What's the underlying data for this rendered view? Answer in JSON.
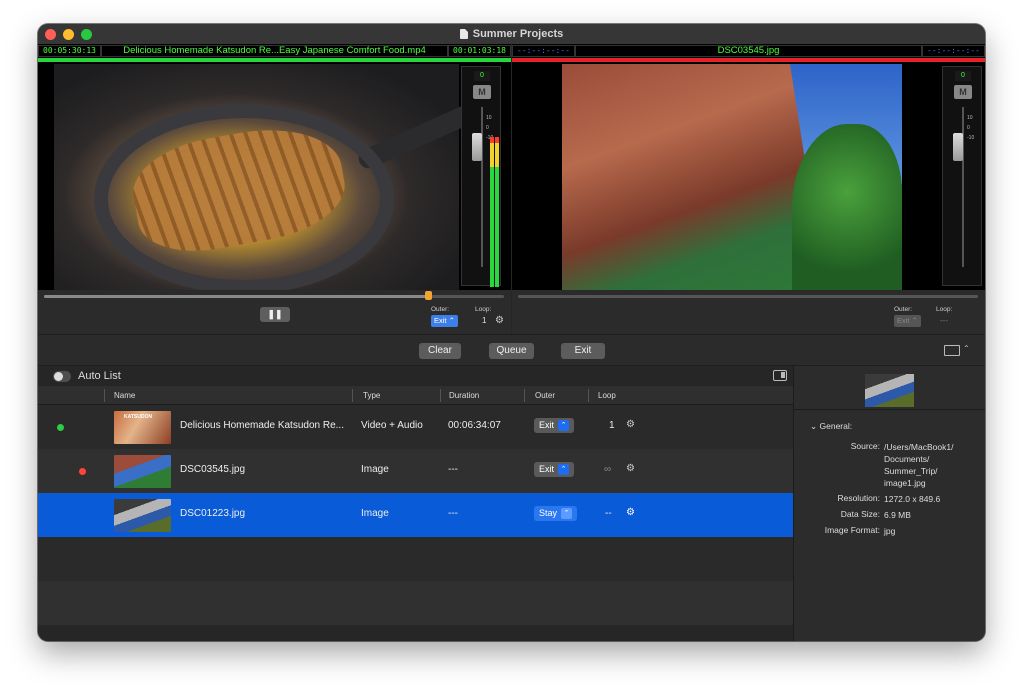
{
  "window": {
    "title": "Summer Projects"
  },
  "preview": {
    "left": {
      "timecode_in": "00:05:30:13",
      "filename": "Delicious Homemade Katsudon Re...Easy Japanese Comfort Food.mp4",
      "timecode_out": "00:01:03:18",
      "level": "0",
      "mute": "M",
      "scale": [
        "10",
        "0",
        "-10"
      ]
    },
    "right": {
      "timecode_in": "--:--:--:--",
      "filename": "DSC03545.jpg",
      "timecode_out": "--:--:--:--",
      "level": "0",
      "mute": "M",
      "scale": [
        "10",
        "0",
        "-10"
      ]
    }
  },
  "transport": {
    "left": {
      "progress": 0.84,
      "pause_label": "❚❚",
      "outer_label": "Outer:",
      "outer_value": "Exit",
      "loop_label": "Loop:",
      "loop_value": "1"
    },
    "right": {
      "outer_label": "Outer:",
      "outer_value": "Exit",
      "loop_label": "Loop:",
      "loop_value": "---"
    }
  },
  "commands": {
    "clear": "Clear",
    "queue": "Queue",
    "exit": "Exit"
  },
  "list": {
    "auto_list_label": "Auto List",
    "columns": {
      "name": "Name",
      "type": "Type",
      "duration": "Duration",
      "outer": "Outer",
      "loop": "Loop"
    },
    "rows": [
      {
        "status_color": "#2ecc40",
        "name": "Delicious Homemade Katsudon Re...",
        "type": "Video + Audio",
        "duration": "00:06:34:07",
        "outer": "Exit",
        "loop": "1"
      },
      {
        "status_color": "#ff453a",
        "name": "DSC03545.jpg",
        "type": "Image",
        "duration": "---",
        "outer": "Exit",
        "loop": "∞"
      },
      {
        "status_color": "",
        "name": "DSC01223.jpg",
        "type": "Image",
        "duration": "---",
        "outer": "Stay",
        "loop": "--"
      }
    ]
  },
  "inspector": {
    "section": "General:",
    "source_label": "Source:",
    "source_value_lines": [
      "/Users/MacBook1/",
      "Documents/",
      "Summer_Trip/",
      "image1.jpg"
    ],
    "resolution_label": "Resolution:",
    "resolution_value": "1272.0 x 849.6",
    "data_size_label": "Data Size:",
    "data_size_value": "6.9 MB",
    "image_format_label": "Image Format:",
    "image_format_value": "jpg"
  }
}
